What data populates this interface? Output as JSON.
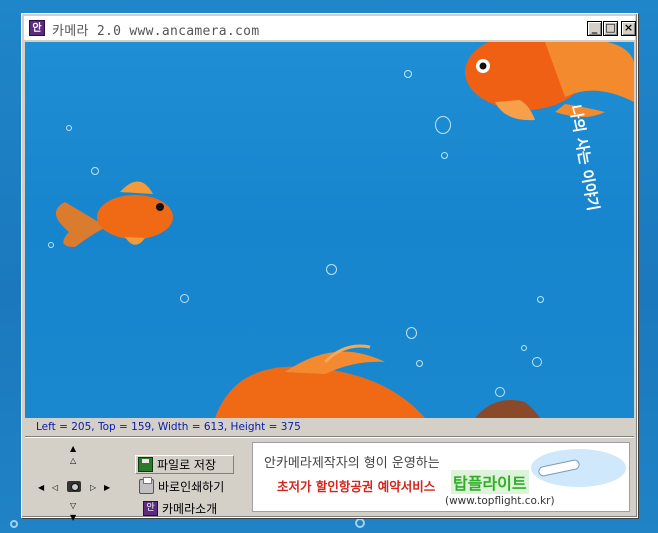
{
  "window": {
    "title": "카메라 2.0 www.ancamera.com",
    "app_icon_glyph": "안",
    "buttons": {
      "minimize": "_",
      "maximize": "□",
      "close": "×"
    }
  },
  "viewport": {
    "overlay_text": "나의 사는 이야기"
  },
  "status": {
    "text": "Left = 205, Top = 159, Width = 613, Height = 375"
  },
  "controls": {
    "nudge_up": "▲",
    "nudge_up_small": "△",
    "nudge_left": "◀",
    "nudge_left_small": "◁",
    "nudge_right_small": "▷",
    "nudge_right": "▶",
    "nudge_down_small": "▽",
    "nudge_down": "▼",
    "menu": {
      "save_label": "파일로 저장",
      "print_label": "바로인쇄하기",
      "about_label": "카메라소개",
      "about_icon_glyph": "안"
    }
  },
  "ad": {
    "line1": "안카메라제작자의 형이 운영하는",
    "line2": "초저가 할인항공권 예약서비스",
    "brand": "탑플라이트",
    "url": "(www.topflight.co.kr)"
  },
  "colors": {
    "status_text": "#0a1aa8",
    "fish_orange": "#f06a16",
    "ocean_blue": "#1a88cf"
  }
}
